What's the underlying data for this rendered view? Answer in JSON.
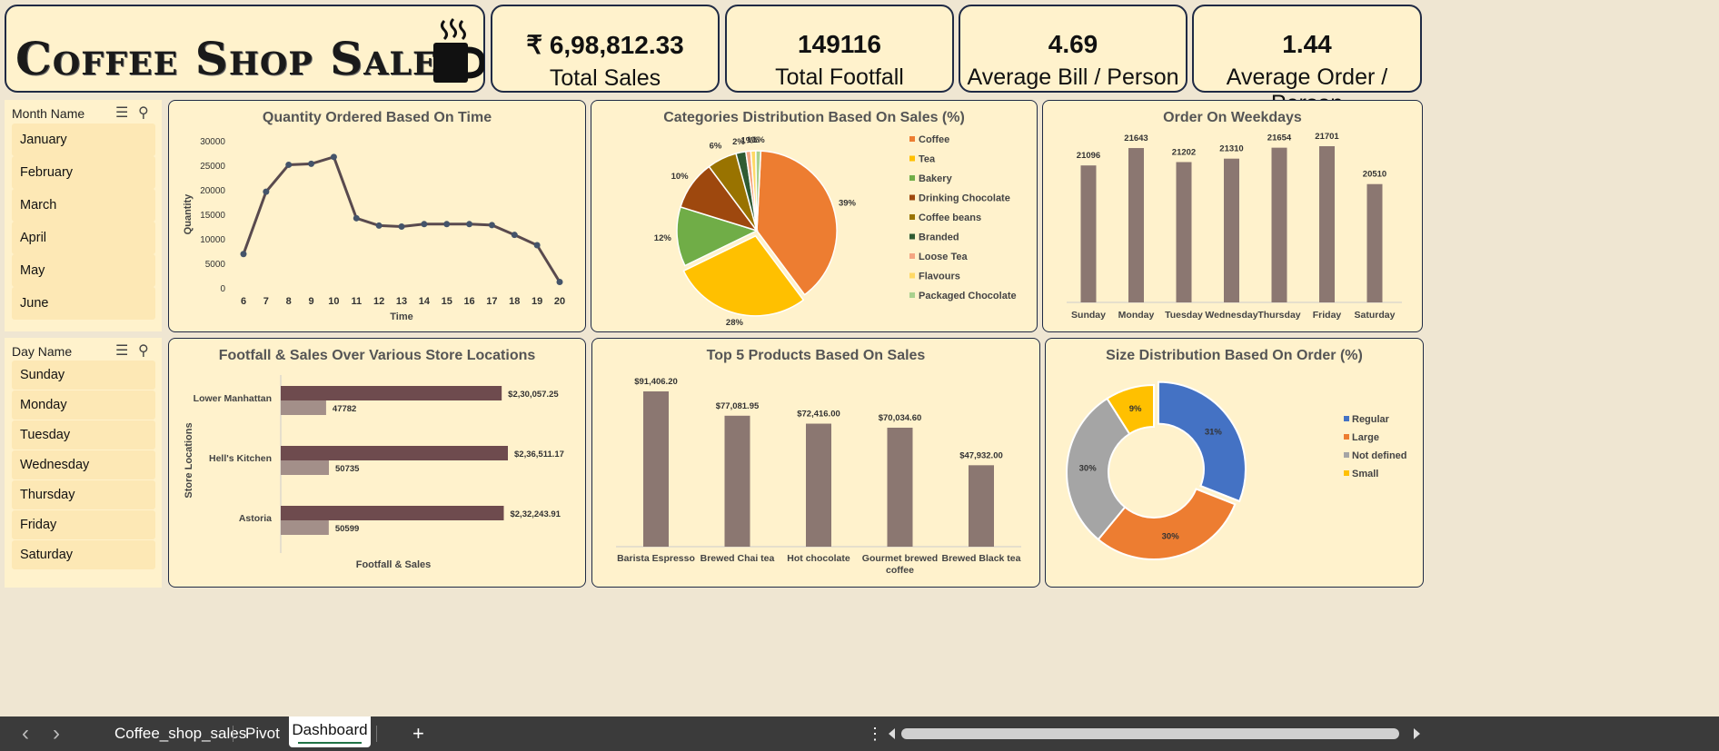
{
  "header": {
    "title": "Coffee Shop Sales"
  },
  "kpis": [
    {
      "value": "₹ 6,98,812.33",
      "label": "Total Sales"
    },
    {
      "value": "149116",
      "label": "Total Footfall"
    },
    {
      "value": "4.69",
      "label": "Average Bill / Person"
    },
    {
      "value": "1.44",
      "label": "Average Order / Person"
    }
  ],
  "month_slicer": {
    "header": "Month Name",
    "items": [
      "January",
      "February",
      "March",
      "April",
      "May",
      "June"
    ]
  },
  "day_slicer": {
    "header": "Day Name",
    "items": [
      "Sunday",
      "Monday",
      "Tuesday",
      "Wednesday",
      "Thursday",
      "Friday",
      "Saturday"
    ]
  },
  "colors": {
    "line": "#594a4e",
    "bar": "#8b7771",
    "loc_sales": "#6e4b4e",
    "loc_foot": "#a38f89",
    "coffee": "#ed7d31",
    "tea": "#ffc000",
    "bakery": "#70ad47",
    "drinking": "#9e480e",
    "beans": "#997300",
    "branded": "#2f5b33",
    "loose": "#f4a582",
    "flavours": "#ffd966",
    "packaged": "#a9d18e",
    "regular": "#4472c4",
    "large": "#ed7d31",
    "notdef": "#a5a5a5",
    "small": "#ffc000"
  },
  "tabs": {
    "prev": "‹",
    "next": "›",
    "items": [
      "Coffee_shop_sales",
      "Pivot",
      "Dashboard"
    ],
    "active": "Dashboard",
    "add": "+",
    "more": "⋮"
  },
  "chart_data": [
    {
      "type": "line",
      "title": "Quantity Ordered Based On Time",
      "xlabel": "Time",
      "ylabel": "Quantity",
      "x": [
        6,
        7,
        8,
        9,
        10,
        11,
        12,
        13,
        14,
        15,
        16,
        17,
        18,
        19,
        20
      ],
      "values": [
        6900,
        19600,
        25100,
        25300,
        26700,
        14200,
        12700,
        12500,
        13000,
        13000,
        13000,
        12800,
        10800,
        8700,
        1200
      ],
      "ylim": [
        0,
        30000
      ],
      "yticks": [
        0,
        5000,
        10000,
        15000,
        20000,
        25000,
        30000
      ]
    },
    {
      "type": "pie",
      "title": "Categories Distribution Based On Sales (%)",
      "categories": [
        "Coffee",
        "Tea",
        "Bakery",
        "Drinking Chocolate",
        "Coffee beans",
        "Branded",
        "Loose Tea",
        "Flavours",
        "Packaged Chocolate"
      ],
      "values": [
        39,
        28,
        12,
        10,
        6,
        2,
        1,
        1,
        1
      ],
      "labels": [
        "39%",
        "28%",
        "12%",
        "10%",
        "6%",
        "2%",
        "1%",
        "1%",
        "1%"
      ],
      "legend": "right"
    },
    {
      "type": "bar",
      "title": "Order On Weekdays",
      "categories": [
        "Sunday",
        "Monday",
        "Tuesday",
        "Wednesday",
        "Thursday",
        "Friday",
        "Saturday"
      ],
      "values": [
        21096,
        21643,
        21202,
        21310,
        21654,
        21701,
        20510
      ]
    },
    {
      "type": "bar",
      "orientation": "horizontal",
      "title": "Footfall & Sales Over Various Store Locations",
      "xlabel": "Footfall & Sales",
      "ylabel": "Store Locations",
      "categories": [
        "Lower Manhattan",
        "Hell's Kitchen",
        "Astoria"
      ],
      "series": [
        {
          "values": [
            230057.25,
            236511.17,
            232243.91
          ],
          "labels": [
            "$2,30,057.25",
            "$2,36,511.17",
            "$2,32,243.91"
          ]
        },
        {
          "values": [
            47782,
            50735,
            50599
          ],
          "labels": [
            "47782",
            "50735",
            "50599"
          ]
        }
      ]
    },
    {
      "type": "bar",
      "title": "Top 5 Products Based On Sales",
      "categories": [
        "Barista Espresso",
        "Brewed Chai tea",
        "Hot chocolate",
        "Gourmet brewed coffee",
        "Brewed Black tea"
      ],
      "values": [
        91406.2,
        77081.95,
        72416.0,
        70034.6,
        47932.0
      ],
      "labels": [
        "$91,406.20",
        "$77,081.95",
        "$72,416.00",
        "$70,034.60",
        "$47,932.00"
      ]
    },
    {
      "type": "pie",
      "subtype": "donut",
      "title": "Size Distribution Based On Order (%)",
      "categories": [
        "Regular",
        "Large",
        "Not defined",
        "Small"
      ],
      "values": [
        31,
        30,
        30,
        9
      ],
      "labels": [
        "31%",
        "30%",
        "30%",
        "9%"
      ],
      "legend": "right"
    }
  ]
}
